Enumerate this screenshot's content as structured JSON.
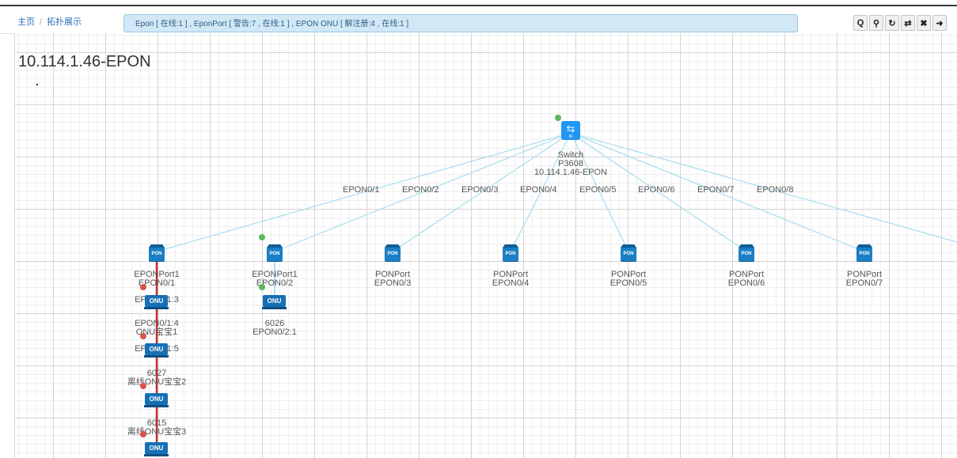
{
  "breadcrumb": {
    "home": "主页",
    "separator": "/",
    "current": "拓扑展示"
  },
  "status_summary": "Epon [ 在线:1 ] , EponPort [ 警告:7 , 在线:1 ] , EPON ONU [ 解注册:4 , 在线:1 ]",
  "toolbar": {
    "search_glyph": "Q",
    "locate_glyph": "⚲",
    "refresh_glyph": "↻",
    "switch_glyph": "⇄",
    "close_glyph": "✖",
    "forward_glyph": "➜"
  },
  "topology_title": "10.114.1.46-EPON",
  "colors": {
    "link": "#a8dcef",
    "online": "#5cb85c",
    "alarm": "#d9534f",
    "onu_link": "#c9302c",
    "node": "#1a7fc4"
  },
  "switch": {
    "icon": "switch-icon",
    "line1": "Switch",
    "line2": "P3608",
    "line3": "10.114.1.46-EPON"
  },
  "port_labels": [
    "EPON0/1",
    "EPON0/2",
    "EPON0/3",
    "EPON0/4",
    "EPON0/5",
    "EPON0/6",
    "EPON0/7",
    "EPON0/8"
  ],
  "ports": [
    {
      "icon_text": "PON",
      "line1": "EPONPort1",
      "line2": "EPON0/1"
    },
    {
      "icon_text": "PON",
      "line1": "EPONPort1",
      "line2": "EPON0/2"
    },
    {
      "icon_text": "PON",
      "line1": "PONPort",
      "line2": "EPON0/3"
    },
    {
      "icon_text": "PON",
      "line1": "PONPort",
      "line2": "EPON0/4"
    },
    {
      "icon_text": "PON",
      "line1": "PONPort",
      "line2": "EPON0/5"
    },
    {
      "icon_text": "PON",
      "line1": "PONPort",
      "line2": "EPON0/6"
    },
    {
      "icon_text": "PON",
      "line1": "PONPort",
      "line2": "EPON0/7"
    }
  ],
  "onus": [
    {
      "icon_text": "ONU",
      "line1": "",
      "line2": "EPON0/1:3"
    },
    {
      "icon_text": "ONU",
      "line1": "EPON0/1:4",
      "line2": "ONU宝宝1"
    },
    {
      "icon_text": "ONU",
      "line1": "",
      "line2": "EPON0/1:5"
    },
    {
      "icon_text": "ONU",
      "line1": "6027",
      "line2": "离线ONU宝宝2"
    },
    {
      "icon_text": "ONU",
      "line1": "6015",
      "line2": "离线ONU宝宝3"
    },
    {
      "icon_text": "ONU",
      "line1": "6026",
      "line2": "EPON0/2:1"
    }
  ]
}
